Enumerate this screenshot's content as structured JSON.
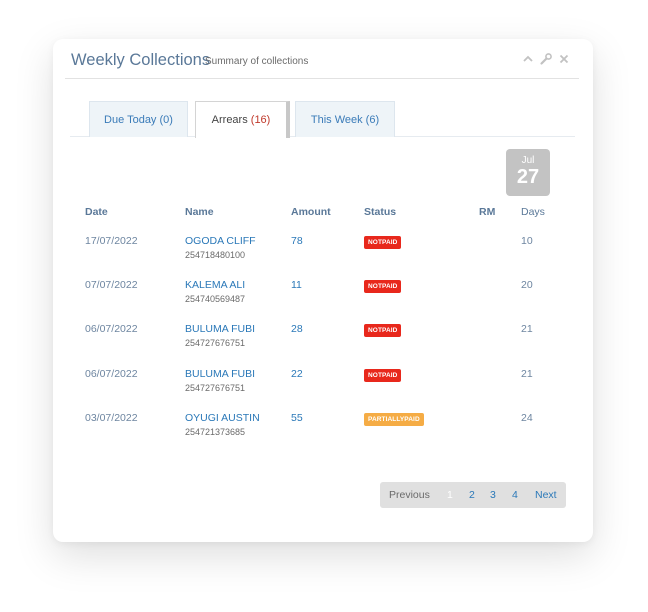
{
  "widget": {
    "title": "Weekly Collections",
    "subtitle": "Summary of collections",
    "icons": [
      "chevron-up-icon",
      "wrench-icon",
      "close-icon"
    ]
  },
  "tabs": [
    {
      "label": "Due Today (0)",
      "active": false
    },
    {
      "label_text": "Arrears ",
      "count": "(16)",
      "active": true
    },
    {
      "label": "This Week (6)",
      "active": false
    }
  ],
  "date_badge": {
    "month": "Jul",
    "day": "27"
  },
  "table": {
    "headers": {
      "date": "Date",
      "name": "Name",
      "amount": "Amount",
      "status": "Status",
      "rm": "RM",
      "days": "Days"
    },
    "rows": [
      {
        "date": "17/07/2022",
        "name": "OGODA CLIFF",
        "phone": "254718480100",
        "amount": "78",
        "status": "NOTPAID",
        "rm": "",
        "days": "10"
      },
      {
        "date": "07/07/2022",
        "name": "KALEMA ALI",
        "phone": "254740569487",
        "amount": "11",
        "status": "NOTPAID",
        "rm": "",
        "days": "20"
      },
      {
        "date": "06/07/2022",
        "name": "BULUMA FUBI",
        "phone": "254727676751",
        "amount": "28",
        "status": "NOTPAID",
        "rm": "",
        "days": "21"
      },
      {
        "date": "06/07/2022",
        "name": "BULUMA FUBI",
        "phone": "254727676751",
        "amount": "22",
        "status": "NOTPAID",
        "rm": "",
        "days": "21"
      },
      {
        "date": "03/07/2022",
        "name": "OYUGI AUSTIN",
        "phone": "254721373685",
        "amount": "55",
        "status": "PARTIALLYPAID",
        "rm": "",
        "days": "24"
      }
    ]
  },
  "pagination": {
    "previous": "Previous",
    "pages": [
      "1",
      "2",
      "3",
      "4"
    ],
    "current": "1",
    "next": "Next"
  },
  "colors": {
    "notpaid": "#e8281c",
    "partiallypaid": "#f5ac45",
    "link": "#2a78b8"
  }
}
